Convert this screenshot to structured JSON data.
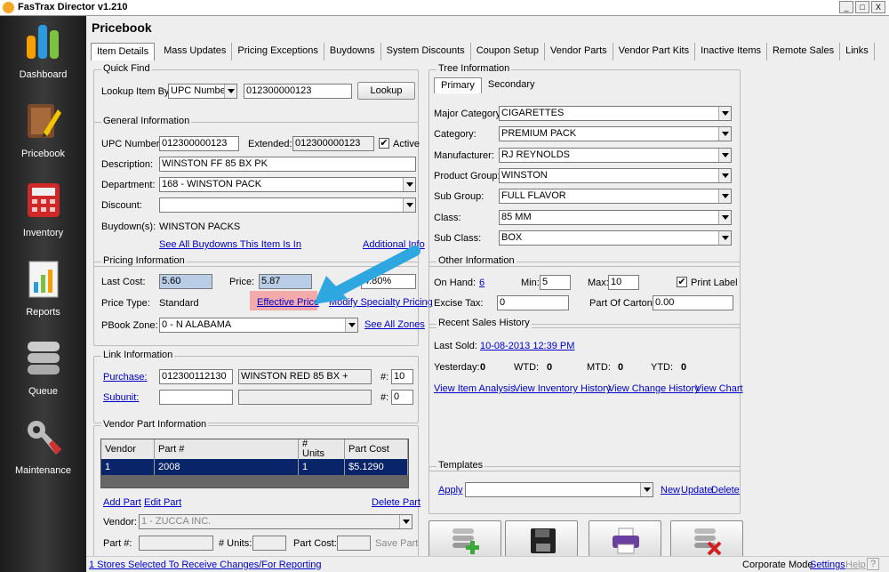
{
  "window": {
    "title": "FasTrax Director v1.210",
    "controls": [
      "_",
      "□",
      "X"
    ]
  },
  "sidebar": {
    "items": [
      {
        "label": "Dashboard",
        "icon": "dashboard-icon"
      },
      {
        "label": "Pricebook",
        "icon": "pricebook-icon"
      },
      {
        "label": "Inventory",
        "icon": "inventory-icon"
      },
      {
        "label": "Reports",
        "icon": "reports-icon"
      },
      {
        "label": "Queue",
        "icon": "queue-icon"
      },
      {
        "label": "Maintenance",
        "icon": "maintenance-icon"
      }
    ]
  },
  "page": {
    "title": "Pricebook"
  },
  "tabs": [
    "Item Details",
    "Mass Updates",
    "Pricing Exceptions",
    "Buydowns",
    "System Discounts",
    "Coupon Setup",
    "Vendor Parts",
    "Vendor Part Kits",
    "Inactive Items",
    "Remote Sales",
    "Links"
  ],
  "quick_find": {
    "legend": "Quick Find",
    "label": "Lookup Item By:",
    "mode": "UPC Number",
    "value": "012300000123",
    "button": "Lookup"
  },
  "general": {
    "legend": "General Information",
    "upc_label": "UPC Number:",
    "upc": "012300000123",
    "ext_label": "Extended:",
    "ext": "012300000123",
    "active_label": "Active",
    "active_check": "✔",
    "desc_label": "Description:",
    "desc": "WINSTON FF 85 BX PK",
    "dept_label": "Department:",
    "dept": "168 - WINSTON PACK",
    "disc_label": "Discount:",
    "disc": "",
    "buydown_label": "Buydown(s):",
    "buydown": "WINSTON PACKS",
    "see_buydowns": "See All Buydowns This Item Is In",
    "additional": "Additional Info"
  },
  "pricing": {
    "legend": "Pricing Information",
    "lastcost_label": "Last Cost:",
    "lastcost": "5.60",
    "price_label": "Price:",
    "price": "5.87",
    "pct": "4.80%",
    "type_label": "Price Type:",
    "type": "Standard",
    "effective": "Effective Price",
    "modify": "Modify Specialty Pricing",
    "zone_label": "PBook Zone:",
    "zone": "0 - N ALABAMA",
    "see_zones": "See All Zones",
    "highlight_color": "#f2aaaa",
    "arrow_color": "#2ea6e0"
  },
  "link": {
    "legend": "Link Information",
    "purchase_label": "Purchase:",
    "purchase": "012300112130",
    "purchase_desc": "WINSTON RED 85 BX +",
    "num_label": "#:",
    "purchase_num": "10",
    "subunit_label": "Subunit:",
    "subunit": "",
    "subunit_desc": "",
    "subunit_num": "0"
  },
  "vendor": {
    "legend": "Vendor Part Information",
    "headers": [
      "Vendor",
      "Part #",
      "#\nUnits",
      "Part Cost"
    ],
    "rows": [
      [
        "1",
        "2008",
        "1",
        "$5.1290"
      ]
    ],
    "add": "Add Part",
    "edit": "Edit Part",
    "delete": "Delete Part",
    "vendor_label": "Vendor:",
    "vendor_value": "1 - ZUCCA INC.",
    "part_label": "Part #:",
    "units_label": "# Units:",
    "cost_label": "Part Cost:",
    "save": "Save Part"
  },
  "tree": {
    "legend": "Tree Information",
    "subtabs": [
      "Primary",
      "Secondary"
    ],
    "fields": [
      {
        "label": "Major Category:",
        "value": "CIGARETTES"
      },
      {
        "label": "Category:",
        "value": "PREMIUM PACK"
      },
      {
        "label": "Manufacturer:",
        "value": "RJ REYNOLDS"
      },
      {
        "label": "Product Group:",
        "value": "WINSTON"
      },
      {
        "label": "Sub Group:",
        "value": "FULL FLAVOR"
      },
      {
        "label": "Class:",
        "value": "85 MM"
      },
      {
        "label": "Sub Class:",
        "value": "BOX"
      }
    ]
  },
  "other": {
    "legend": "Other Information",
    "onhand_label": "On Hand:",
    "onhand": "6",
    "min_label": "Min:",
    "min": "5",
    "max_label": "Max:",
    "max": "10",
    "print_label": "Print Label",
    "print_check": "✔",
    "excise_label": "Excise Tax:",
    "excise": "0",
    "carton_label": "Part Of Carton:",
    "carton": "0.00"
  },
  "sales": {
    "legend": "Recent Sales History",
    "lastsold_label": "Last Sold:",
    "lastsold": "10-08-2013 12:39 PM",
    "ytd_label": "Yesterday:",
    "yesterday": "0",
    "wtd_label": "WTD:",
    "wtd": "0",
    "mtd_label": "MTD:",
    "mtd": "0",
    "ytd2_label": "YTD:",
    "ytd": "0",
    "links": [
      "View Item Analysis",
      "View Inventory History",
      "View Change History",
      "View Chart"
    ]
  },
  "templates": {
    "legend": "Templates",
    "apply": "Apply",
    "value": "",
    "new": "New",
    "update": "Update",
    "delete": "Delete"
  },
  "status": {
    "stores": "1 Stores Selected To Receive Changes/For Reporting",
    "mode": "Corporate Mode",
    "settings": "Settings",
    "help": "Help",
    "q": "?"
  }
}
